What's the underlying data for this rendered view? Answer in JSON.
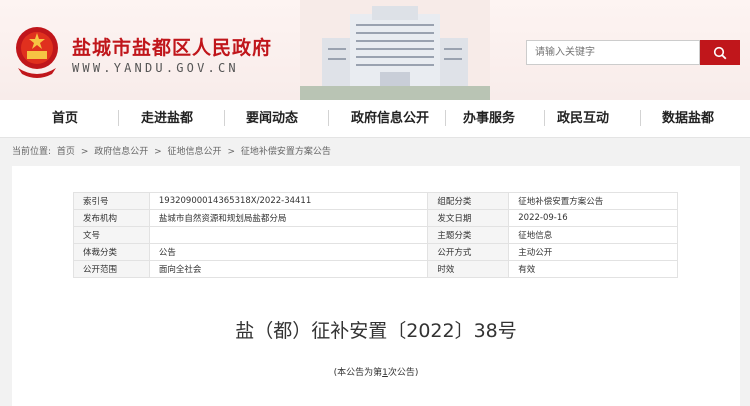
{
  "site": {
    "title": "盐城市盐都区人民政府",
    "domain": "WWW.YANDU.GOV.CN"
  },
  "search": {
    "placeholder": "请输入关键字",
    "icon": "search-icon"
  },
  "nav": [
    "首页",
    "走进盐都",
    "要闻动态",
    "政府信息公开",
    "办事服务",
    "政民互动",
    "数据盐都"
  ],
  "breadcrumb": {
    "label": "当前位置:",
    "items": [
      "首页",
      "政府信息公开",
      "征地信息公开",
      "征地补偿安置方案公告"
    ],
    "separator": ">"
  },
  "meta": {
    "rows": [
      [
        "索引号",
        "19320900014365318X/2022-34411",
        "组配分类",
        "征地补偿安置方案公告"
      ],
      [
        "发布机构",
        "盐城市自然资源和规划局盐都分局",
        "发文日期",
        "2022-09-16"
      ],
      [
        "文号",
        "",
        "主题分类",
        "征地信息"
      ],
      [
        "体裁分类",
        "公告",
        "公开方式",
        "主动公开"
      ],
      [
        "公开范围",
        "面向全社会",
        "时效",
        "有效"
      ]
    ]
  },
  "doc": {
    "title": "盐（都）征补安置〔2022〕38号",
    "sub_prefix": "(本公告为第",
    "sub_num": "1",
    "sub_suffix": "次公告)"
  },
  "colors": {
    "brand": "#c0161b",
    "background": "#f2f2f2"
  }
}
